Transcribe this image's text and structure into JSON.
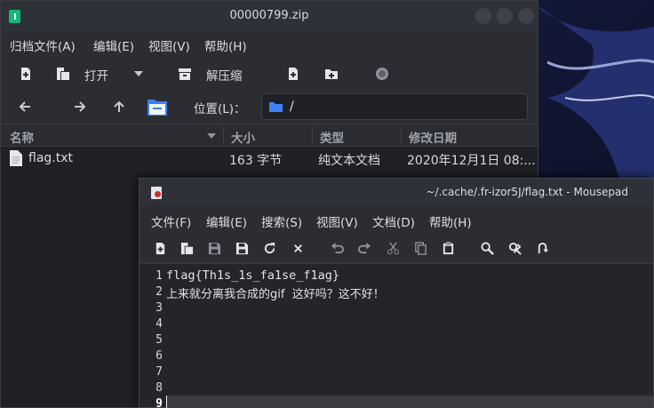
{
  "archive_window": {
    "title": "00000799.zip",
    "menu": [
      "归档文件(A)",
      "编辑(E)",
      "视图(V)",
      "帮助(H)"
    ],
    "toolbar": {
      "open_label": "打开",
      "extract_label": "解压缩"
    },
    "location": {
      "label": "位置(L)：",
      "path": "/"
    },
    "columns": [
      "名称",
      "大小",
      "类型",
      "修改日期"
    ],
    "files": [
      {
        "name": "flag.txt",
        "size": "163 字节",
        "type": "纯文本文档",
        "modified": "2020年12月1日 08:..."
      }
    ]
  },
  "editor_window": {
    "title": "~/.cache/.fr-izor5J/flag.txt - Mousepad",
    "menu": [
      "文件(F)",
      "编辑(E)",
      "搜索(S)",
      "视图(V)",
      "文档(D)",
      "帮助(H)"
    ],
    "line_numbers": [
      "1",
      "2",
      "3",
      "4",
      "5",
      "6",
      "7",
      "8",
      "9"
    ],
    "lines": [
      "flag{Th1s_1s_fa1se_f1ag}",
      "上来就分离我合成的gif  这好吗？这不好！",
      "",
      "",
      "",
      "",
      "",
      "",
      ""
    ]
  },
  "colors": {
    "accent_folder": "#3b82f6",
    "archive_icon": "#17b47e"
  }
}
